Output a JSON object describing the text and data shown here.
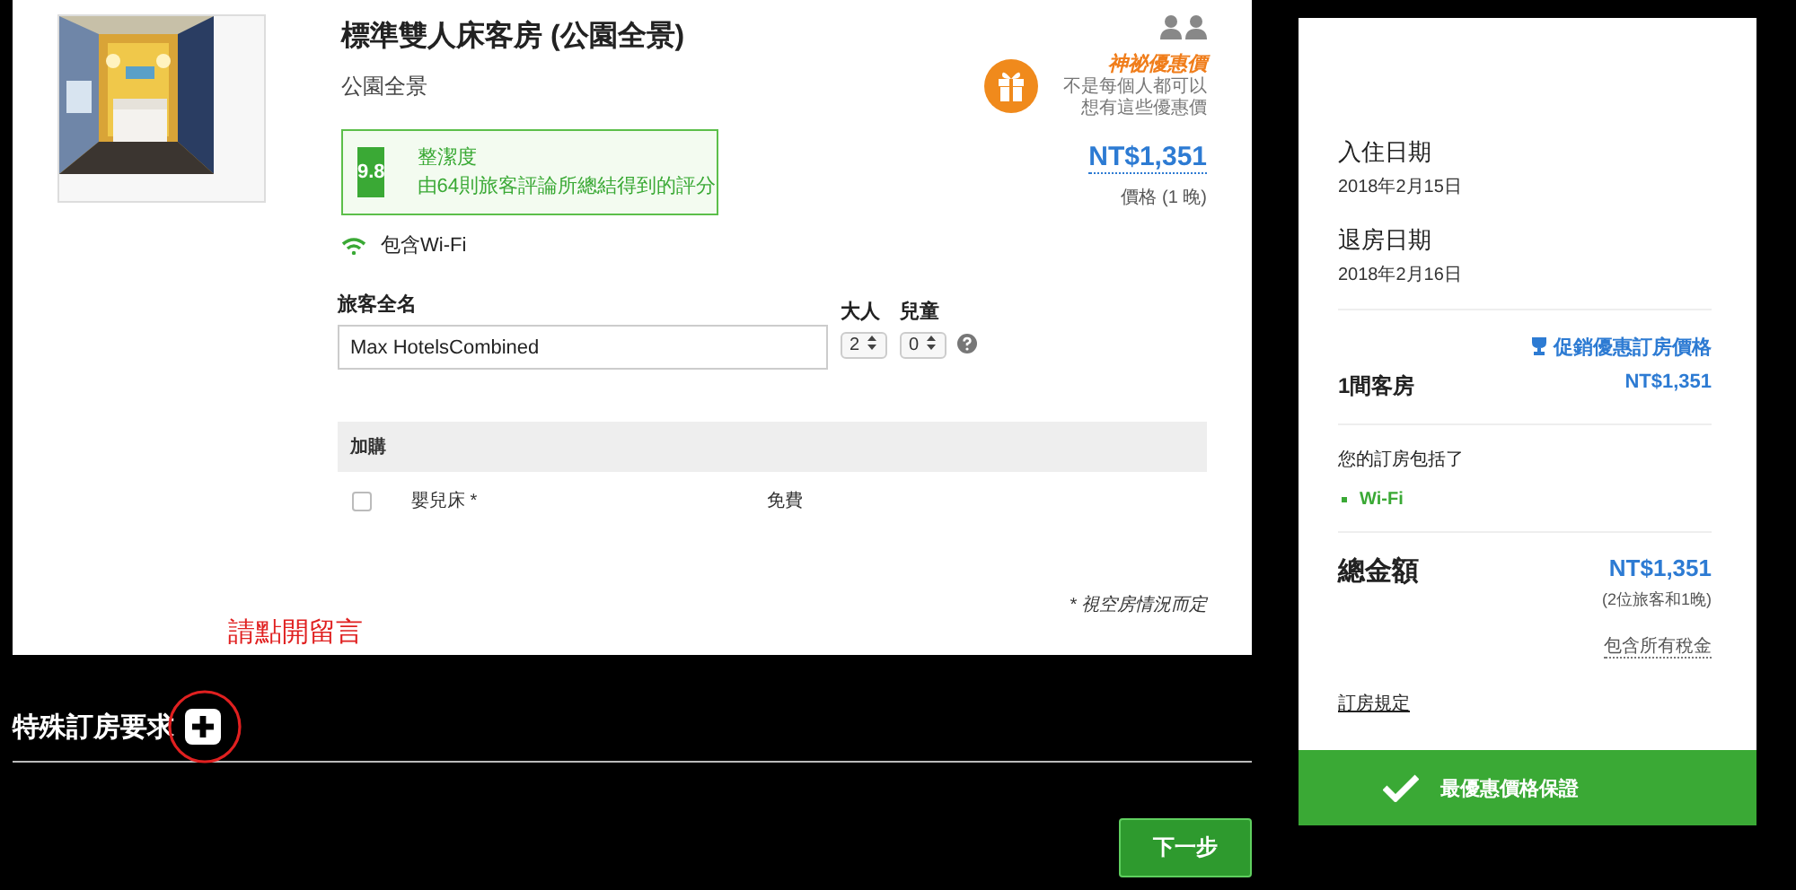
{
  "room": {
    "title": "標準雙人床客房 (公園全景)",
    "subtitle": "公園全景",
    "rating": {
      "score": "9.8",
      "label": "整潔度",
      "description": "由64則旅客評論所總結得到的評分"
    },
    "amenity": "包含Wi-Fi",
    "deal": {
      "title": "神祕優惠價",
      "description": "不是每個人都可以想有這些優惠價"
    },
    "price": "NT$1,351",
    "price_note": "價格 (1 晚)"
  },
  "guest_form": {
    "name_label": "旅客全名",
    "name_value": "Max HotelsCombined",
    "adults_label": "大人",
    "adults_value": "2",
    "children_label": "兒童",
    "children_value": "0"
  },
  "addons": {
    "header": "加購",
    "items": [
      {
        "name": "嬰兒床 *",
        "price": "免費",
        "checked": false
      }
    ]
  },
  "footnote": "* 視空房情況而定",
  "annotation": "請點開留言",
  "special_requests": {
    "title": "特殊訂房要求"
  },
  "next_button": "下一步",
  "summary": {
    "check_in_label": "入住日期",
    "check_in_date": "2018年2月15日",
    "check_out_label": "退房日期",
    "check_out_date": "2018年2月16日",
    "promo_link": "促銷優惠訂房價格",
    "rooms_label": "1間客房",
    "rooms_price": "NT$1,351",
    "includes_label": "您的訂房包括了",
    "includes": [
      "Wi-Fi"
    ],
    "total_label": "總金額",
    "total_price": "NT$1,351",
    "total_note": "(2位旅客和1晚)",
    "tax_note": "包含所有稅金",
    "policy_link": "訂房規定",
    "guarantee": "最優惠價格保證"
  }
}
